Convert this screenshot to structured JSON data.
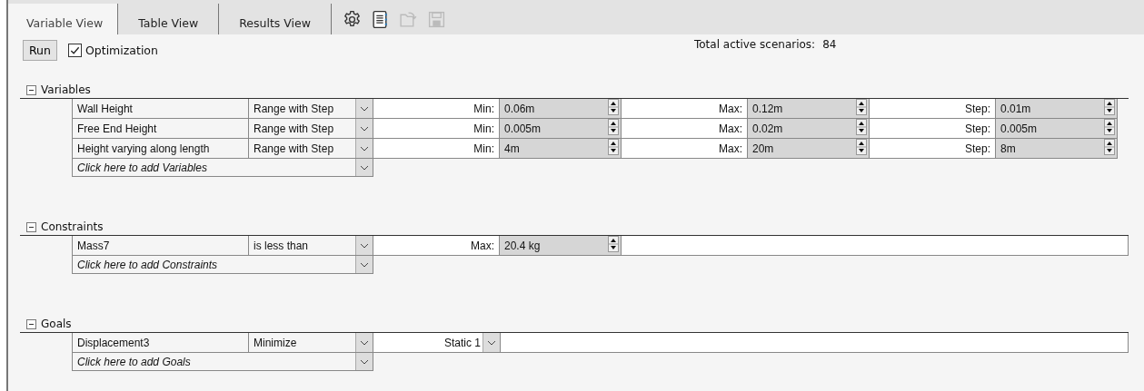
{
  "tabs": [
    {
      "label": "Variable View",
      "selected": true
    },
    {
      "label": "Table View",
      "selected": false
    },
    {
      "label": "Results View",
      "selected": false
    }
  ],
  "toolbar_icons": [
    {
      "kind": "gear",
      "disabled": false
    },
    {
      "kind": "notebook",
      "disabled": false
    },
    {
      "kind": "folder",
      "disabled": true
    },
    {
      "kind": "save",
      "disabled": true
    }
  ],
  "run_button": "Run",
  "optimization": {
    "label": "Optimization",
    "checked": true
  },
  "total_scenarios": {
    "label": "Total active scenarios:",
    "value": "84"
  },
  "sections": [
    {
      "title": "Variables",
      "expanded": true,
      "rows": [
        {
          "name": "Wall Height",
          "type": "Range with Step",
          "cells": [
            {
              "kind": "spin",
              "label": "Min:",
              "value": "0.06m"
            },
            {
              "kind": "spin",
              "label": "Max:",
              "value": "0.12m"
            },
            {
              "kind": "spin",
              "label": "Step:",
              "value": "0.01m"
            }
          ]
        },
        {
          "name": "Free End Height",
          "type": "Range with Step",
          "cells": [
            {
              "kind": "spin",
              "label": "Min:",
              "value": "0.005m"
            },
            {
              "kind": "spin",
              "label": "Max:",
              "value": "0.02m"
            },
            {
              "kind": "spin",
              "label": "Step:",
              "value": "0.005m"
            }
          ]
        },
        {
          "name": "Height varying along length",
          "type": "Range with Step",
          "cells": [
            {
              "kind": "spin",
              "label": "Min:",
              "value": "4m"
            },
            {
              "kind": "spin",
              "label": "Max:",
              "value": "20m"
            },
            {
              "kind": "spin",
              "label": "Step:",
              "value": "8m"
            }
          ]
        }
      ],
      "add_row": "Click here to add Variables"
    },
    {
      "title": "Constraints",
      "expanded": true,
      "rows": [
        {
          "name": "Mass7",
          "type": "is less than",
          "cells": [
            {
              "kind": "spin",
              "label": "Max:",
              "value": "20.4 kg"
            },
            {
              "kind": "empty"
            }
          ]
        }
      ],
      "add_row": "Click here to add Constraints"
    },
    {
      "title": "Goals",
      "expanded": true,
      "rows": [
        {
          "name": "Displacement3",
          "type": "Minimize",
          "cells": [
            {
              "kind": "select",
              "value": "Static 1"
            },
            {
              "kind": "empty"
            }
          ]
        }
      ],
      "add_row": "Click here to add Goals"
    }
  ]
}
